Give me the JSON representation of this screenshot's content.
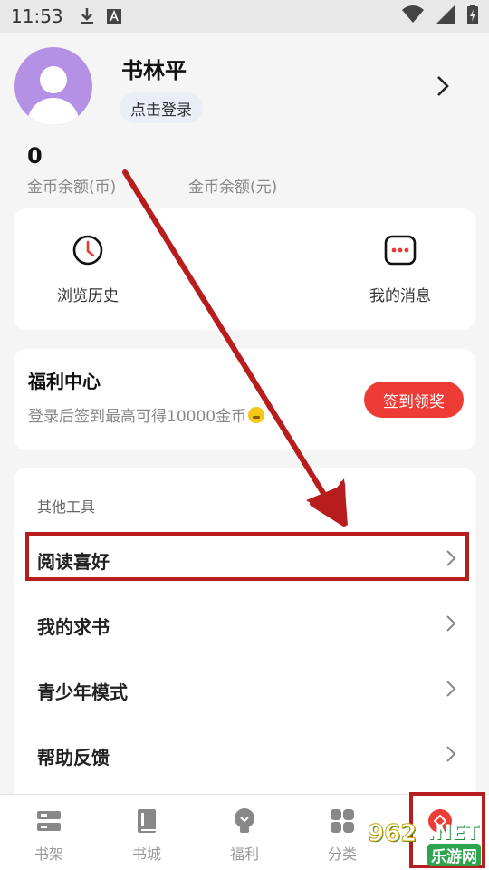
{
  "status_bar": {
    "time": "11:53"
  },
  "profile": {
    "username": "书林平",
    "login_label": "点击登录"
  },
  "coins": {
    "value": "0",
    "label_coins": "金币余额(币)",
    "label_yuan": "金币余额(元)"
  },
  "quick": {
    "history_label": "浏览历史",
    "messages_label": "我的消息"
  },
  "welfare": {
    "title": "福利中心",
    "description": "登录后签到最高可得10000金币",
    "button_label": "签到领奖"
  },
  "tools": {
    "title": "其他工具",
    "items": [
      {
        "label": "阅读喜好"
      },
      {
        "label": "我的求书"
      },
      {
        "label": "青少年模式"
      },
      {
        "label": "帮助反馈"
      }
    ]
  },
  "bottom_nav": {
    "items": [
      {
        "label": "书架",
        "icon": "bookshelf-icon"
      },
      {
        "label": "书城",
        "icon": "book-icon"
      },
      {
        "label": "福利",
        "icon": "bulb-icon"
      },
      {
        "label": "分类",
        "icon": "grid-icon"
      },
      {
        "label": "",
        "icon": "profile-icon"
      }
    ]
  },
  "watermark": {
    "number": "962",
    "net": ".NET",
    "name": "乐游网"
  },
  "colors": {
    "accent_red": "#ef3b36",
    "annotation_red": "#b81d1d",
    "avatar_purple": "#b591e6",
    "background": "#f5f5f5"
  }
}
